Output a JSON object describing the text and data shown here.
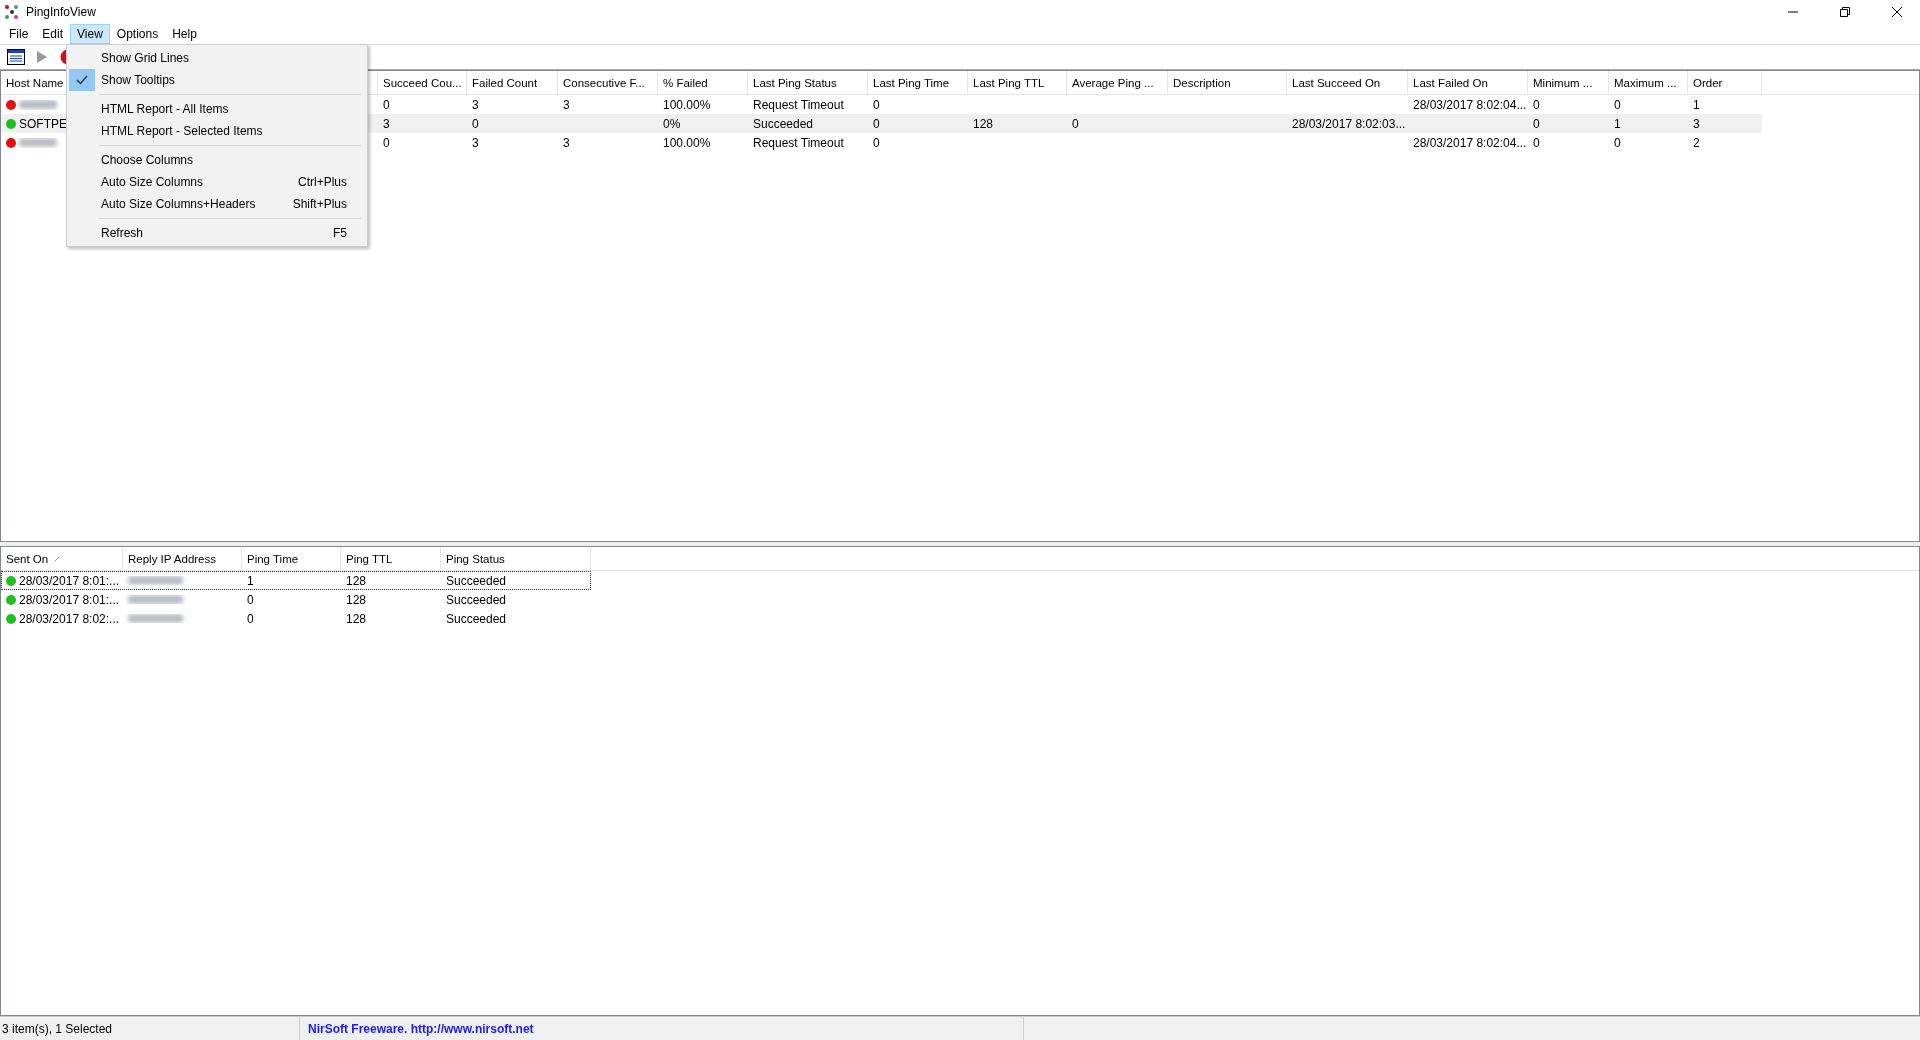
{
  "window": {
    "title": "PingInfoView"
  },
  "menu_bar": [
    {
      "label": "File",
      "selected": false
    },
    {
      "label": "Edit",
      "selected": false
    },
    {
      "label": "View",
      "selected": true
    },
    {
      "label": "Options",
      "selected": false
    },
    {
      "label": "Help",
      "selected": false
    }
  ],
  "view_menu": [
    {
      "kind": "item",
      "label": "Show Grid Lines",
      "checked": false
    },
    {
      "kind": "item",
      "label": "Show Tooltips",
      "checked": true
    },
    {
      "kind": "separator"
    },
    {
      "kind": "item",
      "label": "HTML Report - All Items",
      "checked": false
    },
    {
      "kind": "item",
      "label": "HTML Report - Selected Items",
      "checked": false
    },
    {
      "kind": "separator"
    },
    {
      "kind": "item",
      "label": "Choose Columns",
      "checked": false
    },
    {
      "kind": "item",
      "label": "Auto Size Columns",
      "shortcut": "Ctrl+Plus",
      "checked": false
    },
    {
      "kind": "item",
      "label": "Auto Size Columns+Headers",
      "shortcut": "Shift+Plus",
      "checked": false
    },
    {
      "kind": "separator"
    },
    {
      "kind": "item",
      "label": "Refresh",
      "shortcut": "F5",
      "checked": false
    }
  ],
  "hosts_table": {
    "columns": [
      "Host Name",
      "Succeed Cou...",
      "Failed Count",
      "Consecutive F...",
      "% Failed",
      "Last Ping Status",
      "Last Ping Time",
      "Last Ping TTL",
      "Average Ping ...",
      "Description",
      "Last Succeed On",
      "Last Failed On",
      "Minimum ...",
      "Maximum ...",
      "Order"
    ],
    "rows": [
      {
        "color": "#e01010",
        "selected": false,
        "cells": [
          null,
          "0",
          "3",
          "3",
          "100.00%",
          "Request Timeout",
          "0",
          null,
          null,
          null,
          null,
          "28/03/2017 8:02:04...",
          "0",
          "0",
          "1"
        ]
      },
      {
        "color": "#20c020",
        "selected": true,
        "cells": [
          "SOFTPE",
          "3",
          "0",
          null,
          "0%",
          "Succeeded",
          "0",
          "128",
          "0",
          null,
          "28/03/2017 8:02:03...",
          null,
          "0",
          "1",
          "3"
        ]
      },
      {
        "color": "#e01010",
        "selected": false,
        "cells": [
          null,
          "0",
          "3",
          "3",
          "100.00%",
          "Request Timeout",
          "0",
          null,
          null,
          null,
          null,
          "28/03/2017 8:02:04...",
          "0",
          "0",
          "2"
        ]
      }
    ]
  },
  "ping_table": {
    "columns": [
      {
        "label": "Sent On",
        "sorted": true
      },
      {
        "label": "Reply IP Address",
        "sorted": false
      },
      {
        "label": "Ping Time",
        "sorted": false
      },
      {
        "label": "Ping TTL",
        "sorted": false
      },
      {
        "label": "Ping Status",
        "sorted": false
      }
    ],
    "rows": [
      {
        "color": "#20c020",
        "focused": true,
        "sent_on": "28/03/2017 8:01:...",
        "ping_time": "1",
        "ping_ttl": "128",
        "ping_status": "Succeeded"
      },
      {
        "color": "#20c020",
        "focused": false,
        "sent_on": "28/03/2017 8:01:...",
        "ping_time": "0",
        "ping_ttl": "128",
        "ping_status": "Succeeded"
      },
      {
        "color": "#20c020",
        "focused": false,
        "sent_on": "28/03/2017 8:02:...",
        "ping_time": "0",
        "ping_ttl": "128",
        "ping_status": "Succeeded"
      }
    ]
  },
  "status_bar": [
    {
      "kind": "text",
      "text": "3 item(s), 1 Selected"
    },
    {
      "kind": "link",
      "text": "NirSoft Freeware.  http://www.nirsoft.net"
    }
  ]
}
